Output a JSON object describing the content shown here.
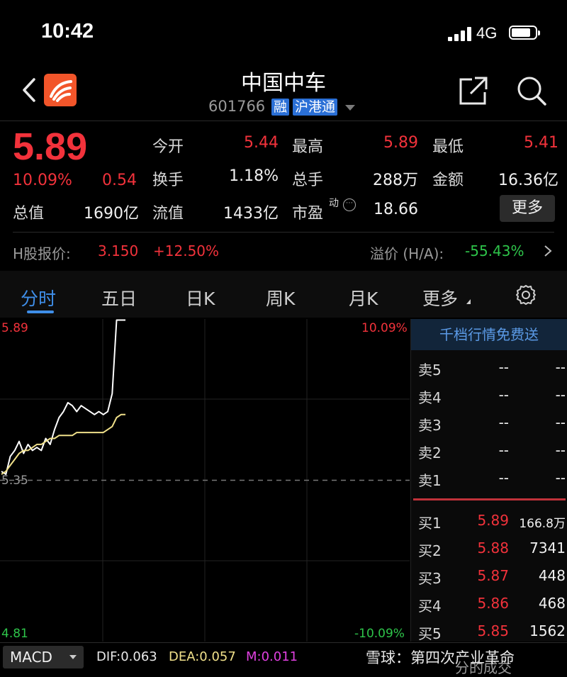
{
  "status_bar": {
    "time": "10:42",
    "network": "4G"
  },
  "header": {
    "title": "中国中车",
    "code": "601766",
    "tags": [
      "融",
      "沪港通"
    ]
  },
  "quote": {
    "price": "5.89",
    "change_pct": "10.09%",
    "change_amt": "0.54",
    "stats": [
      {
        "label": "今开",
        "value": "5.44",
        "color": "red"
      },
      {
        "label": "最高",
        "value": "5.89",
        "color": "red"
      },
      {
        "label": "最低",
        "value": "5.41",
        "color": "red"
      },
      {
        "label": "换手",
        "value": "1.18%",
        "color": "white"
      },
      {
        "label": "总手",
        "value": "288万",
        "color": "white"
      },
      {
        "label": "金额",
        "value": "16.36亿",
        "color": "white"
      },
      {
        "label": "总值",
        "value": "1690亿",
        "color": "white"
      },
      {
        "label": "流值",
        "value": "1433亿",
        "color": "white"
      },
      {
        "label": "市盈",
        "value": "18.66",
        "color": "white",
        "superscript": "动"
      }
    ],
    "more_label": "更多"
  },
  "h_share": {
    "label": "H股报价:",
    "price": "3.150",
    "change": "+12.50%",
    "premium_label": "溢价 (H/A):",
    "premium": "-55.43%"
  },
  "tabs": [
    {
      "label": "分时",
      "active": true
    },
    {
      "label": "五日",
      "active": false
    },
    {
      "label": "日K",
      "active": false
    },
    {
      "label": "周K",
      "active": false
    },
    {
      "label": "月K",
      "active": false
    },
    {
      "label": "更多",
      "active": false
    }
  ],
  "chart_data": {
    "type": "line",
    "y_left_labels": {
      "top": "5.89",
      "mid": "5.35",
      "bottom": "4.81"
    },
    "y_right_labels": {
      "top": "10.09%",
      "bottom": "-10.09%"
    },
    "ylim": [
      4.81,
      5.89
    ],
    "prev_close": 5.35,
    "series": [
      {
        "values": [
          5.38,
          5.37,
          5.43,
          5.45,
          5.48,
          5.44,
          5.47,
          5.45,
          5.46,
          5.45,
          5.49,
          5.47,
          5.52,
          5.56,
          5.58,
          5.61,
          5.6,
          5.58,
          5.6,
          5.59,
          5.58,
          5.57,
          5.58,
          5.57,
          5.58,
          5.64,
          5.89,
          5.89,
          5.89
        ]
      },
      {
        "values": [
          5.37,
          5.38,
          5.4,
          5.42,
          5.44,
          5.45,
          5.45,
          5.46,
          5.47,
          5.47,
          5.48,
          5.49,
          5.49,
          5.5,
          5.5,
          5.5,
          5.5,
          5.51,
          5.51,
          5.51,
          5.51,
          5.51,
          5.51,
          5.51,
          5.52,
          5.53,
          5.56,
          5.57,
          5.57
        ]
      }
    ],
    "colors": {
      "price": "#ffffff",
      "avg": "#f0e08a"
    }
  },
  "order_book": {
    "header": "千档行情免费送",
    "asks": [
      {
        "label": "卖5",
        "price": "--",
        "volume": "--"
      },
      {
        "label": "卖4",
        "price": "--",
        "volume": "--"
      },
      {
        "label": "卖3",
        "price": "--",
        "volume": "--"
      },
      {
        "label": "卖2",
        "price": "--",
        "volume": "--"
      },
      {
        "label": "卖1",
        "price": "--",
        "volume": "--"
      }
    ],
    "bids": [
      {
        "label": "买1",
        "price": "5.89",
        "volume": "166.8万"
      },
      {
        "label": "买2",
        "price": "5.88",
        "volume": "7341"
      },
      {
        "label": "买3",
        "price": "5.87",
        "volume": "448"
      },
      {
        "label": "买4",
        "price": "5.86",
        "volume": "468"
      },
      {
        "label": "买5",
        "price": "5.85",
        "volume": "1562"
      }
    ]
  },
  "indicator": {
    "name": "MACD",
    "dif": "DIF:0.063",
    "dea": "DEA:0.057",
    "m": "M:0.011"
  },
  "watermark": {
    "main": "雪球：第四次产业革命",
    "sub": "分的成交"
  }
}
